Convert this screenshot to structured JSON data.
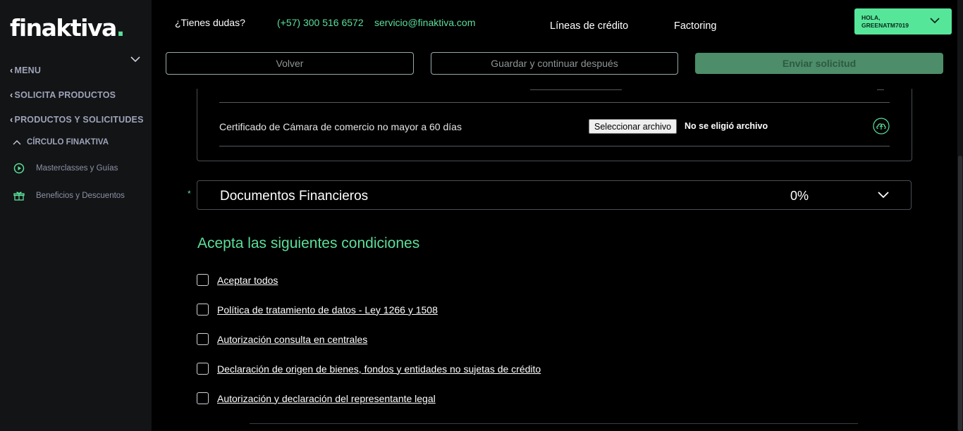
{
  "sidebar": {
    "logo": "finaktiva",
    "logo_dot": ".",
    "menu": "MENU",
    "items": [
      {
        "label": "SOLICITA PRODUCTOS"
      },
      {
        "label": "PRODUCTOS Y SOLICITUDES"
      }
    ],
    "circle": "CÍRCULO FINAKTIVA",
    "sub_items": [
      {
        "label": "Masterclasses y Guías",
        "icon": "play-circle-icon"
      },
      {
        "label": "Beneficios y Descuentos",
        "icon": "gift-icon"
      }
    ]
  },
  "header": {
    "question": "¿Tienes dudas?",
    "phone": "(+57) 300 516 6572",
    "email": "servicio@finaktiva.com",
    "nav": [
      "Líneas de crédito",
      "Factoring"
    ],
    "user_greeting_1": "HOLA,",
    "user_greeting_2": "GREENATM7019"
  },
  "actions": {
    "back": "Volver",
    "save": "Guardar y continuar después",
    "send": "Enviar solicitud"
  },
  "documents": {
    "certificate_label": "Certificado de Cámara de comercio no mayor a 60 días",
    "file_button": "Seleccionar archivo",
    "file_status": "No se eligió archivo"
  },
  "financial": {
    "asterisk": "*",
    "title": "Documentos Financieros",
    "percent": "0%"
  },
  "conditions": {
    "title": "Acepta las siguientes condiciones",
    "items": [
      "Aceptar todos",
      "Política de tratamiento de datos - Ley 1266 y 1508",
      "Autorización consulta en centrales",
      "Declaración de origen de bienes, fondos y entidades no sujetas de crédito",
      "Autorización y declaración del representante legal"
    ]
  },
  "colors": {
    "accent": "#5bdf9a",
    "sidebar_bg": "#131416",
    "button_disabled": "#4d8d69"
  }
}
